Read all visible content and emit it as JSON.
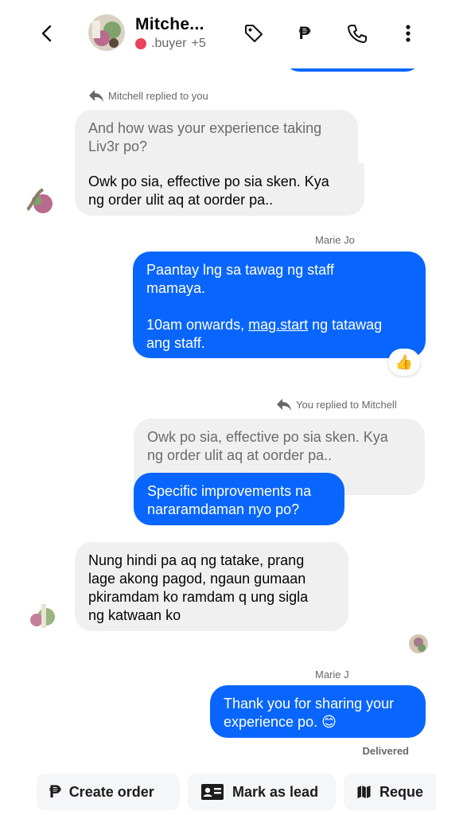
{
  "header": {
    "title": "Mitche...",
    "subtitle": ".buyer",
    "extra_count": "+5",
    "peso_symbol": "₱"
  },
  "messages": {
    "reply_label_1": "Mitchell replied to you",
    "quoted_1": [
      "And how was your experience taking",
      "Liv3r po?"
    ],
    "incoming_1": [
      "Owk po sia, effective po sia sken. Kya",
      "ng order ulit aq at oorder pa.."
    ],
    "sender_1": "Marie Jo",
    "outgoing_1_a": [
      "Paantay lng sa tawag ng staff",
      "mamaya."
    ],
    "outgoing_1_b_prefix": "10am onwards, ",
    "outgoing_1_b_link": "mag.start",
    "outgoing_1_b_suffix": " ng tatawag",
    "outgoing_1_b_line2": "ang staff.",
    "reaction": "👍",
    "reply_label_2": "You replied to Mitchell",
    "quoted_2": [
      "Owk po sia, effective po sia sken. Kya",
      "ng order ulit aq at oorder pa.."
    ],
    "outgoing_2": [
      "Specific improvements na",
      "nararamdaman nyo po?"
    ],
    "incoming_2": [
      "Nung hindi pa aq ng tatake, prang",
      "lage akong pagod, ngaun gumaan",
      "pkiramdam ko ramdam q ung sigla",
      "ng katwaan ko"
    ],
    "sender_2": "Marie J",
    "outgoing_3": [
      "Thank you for sharing your",
      "experience po. 😊"
    ],
    "delivered": "Delivered"
  },
  "actions": {
    "create_order": "Create order",
    "mark_as_lead": "Mark as lead",
    "request": "Reque"
  },
  "colors": {
    "accent": "#0866ff",
    "incoming_bg": "#f0f0f0",
    "status_dot": "#e8435a"
  }
}
